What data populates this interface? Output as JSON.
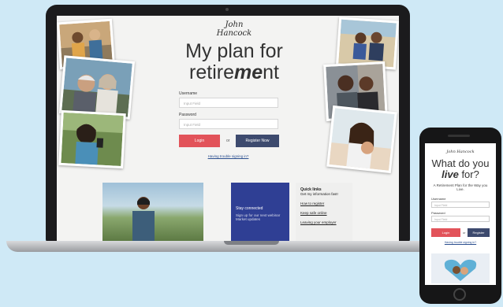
{
  "desktop": {
    "logo": "John Hancock",
    "headline_line1": "My plan for",
    "headline_line2_pre": "retire",
    "headline_line2_em": "me",
    "headline_line2_post": "nt",
    "username_label": "Username",
    "username_placeholder": "Input Field",
    "password_label": "Password",
    "password_placeholder": "Input Field",
    "login_button": "Login",
    "or_text": "or",
    "register_button": "Register Now",
    "trouble_link": "Having trouble signing in?",
    "stay_connected_title": "Stay connected",
    "stay_connected_text": "Sign up for our next webinar Market updates",
    "quick_links": {
      "title": "Quick links",
      "subtitle": "Get my information fast!",
      "items": [
        "How to register",
        "Keep safe online",
        "Leaving your employer"
      ]
    }
  },
  "mobile": {
    "logo": "John Hancock",
    "headline_line1": "What do you",
    "headline_em": "live",
    "headline_line2_post": " for?",
    "subtitle": "A Retirement Plan for the Way you Live.",
    "username_label": "Username",
    "username_placeholder": "Input Field",
    "password_label": "Password",
    "password_placeholder": "Input Field",
    "login_button": "Login",
    "or_text": "or",
    "register_button": "Register",
    "trouble_link": "Having trouble signing in?"
  },
  "colors": {
    "background": "#cfe9f6",
    "login_red": "#e2535a",
    "register_navy": "#3d4a6e",
    "promo_blue": "#2f3f94"
  }
}
